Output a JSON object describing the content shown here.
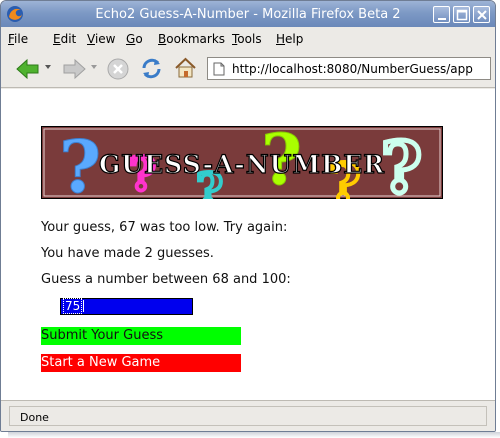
{
  "window": {
    "title": "Echo2 Guess-A-Number - Mozilla Firefox Beta 2"
  },
  "menubar": {
    "items": [
      {
        "first": "F",
        "rest": "ile"
      },
      {
        "first": "E",
        "rest": "dit"
      },
      {
        "first": "V",
        "rest": "iew"
      },
      {
        "first": "G",
        "rest": "o"
      },
      {
        "first": "B",
        "rest": "ookmarks"
      },
      {
        "first": "T",
        "rest": "ools"
      },
      {
        "first": "H",
        "rest": "elp"
      }
    ]
  },
  "navbar": {
    "url": "http://localhost:8080/NumberGuess/app",
    "icons": [
      "back-arrow-icon",
      "forward-arrow-icon",
      "stop-icon",
      "reload-icon",
      "home-icon"
    ]
  },
  "banner": {
    "title": "GUESS-A-NUMBER",
    "colors": {
      "background": "#7a3b3b",
      "question_marks": [
        "#5aa9ff",
        "#ff33cc",
        "#33cccc",
        "#aaff00",
        "#ffcc00",
        "#ccffee"
      ]
    }
  },
  "game": {
    "feedback": "Your guess, 67 was too low. Try again:",
    "guess_count": "You have made 2 guesses.",
    "range_prompt": "Guess a number between 68 and 100:",
    "input_value": "75",
    "submit_label": "Submit Your Guess",
    "newgame_label": "Start a New Game",
    "colors": {
      "input_bg": "#0000ee",
      "submit_bg": "#00ff00",
      "newgame_bg": "#ff0000"
    }
  },
  "status": {
    "text": "Done"
  }
}
